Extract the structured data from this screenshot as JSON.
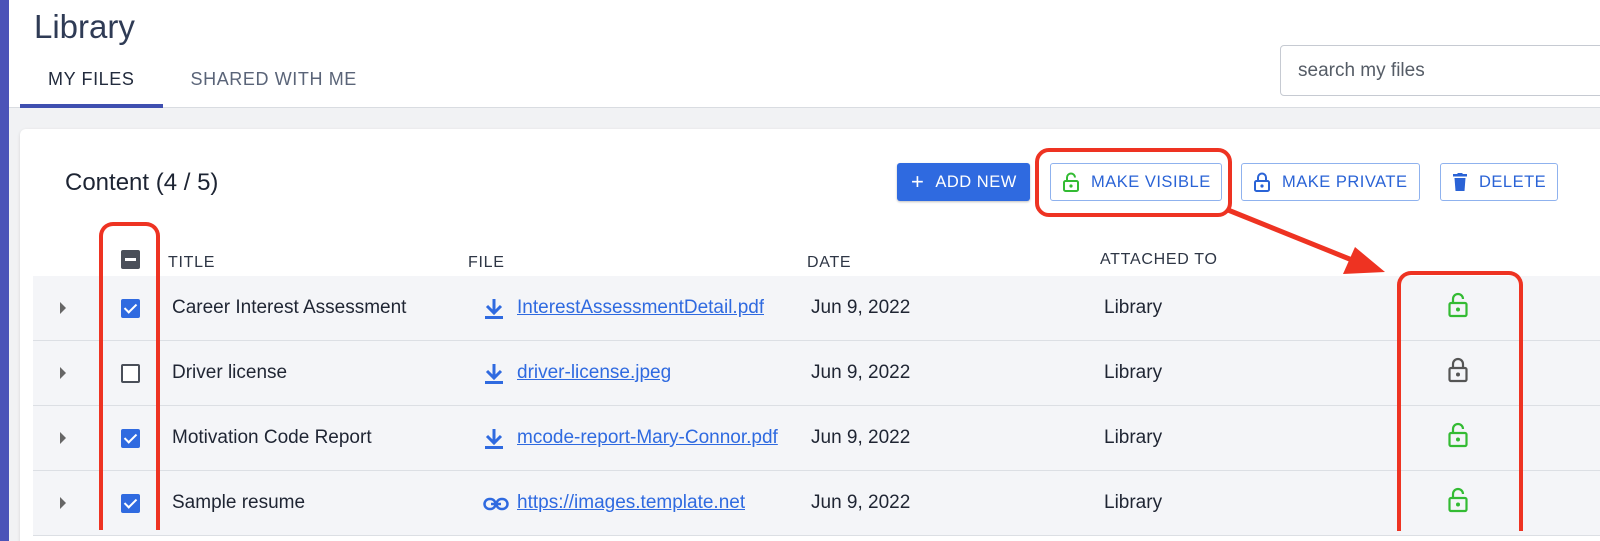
{
  "header": {
    "title": "Library",
    "tabs": [
      {
        "label": "MY FILES",
        "active": true
      },
      {
        "label": "SHARED WITH ME",
        "active": false
      }
    ],
    "search": {
      "placeholder": "search my files",
      "value": ""
    }
  },
  "content": {
    "title": "Content (4 / 5)",
    "toolbar": {
      "add_new": "ADD NEW",
      "make_visible": "MAKE VISIBLE",
      "make_private": "MAKE PRIVATE",
      "delete": "DELETE"
    },
    "columns": [
      "TITLE",
      "FILE",
      "DATE",
      "ATTACHED TO"
    ],
    "rows": [
      {
        "title": "Career Interest Assessment",
        "file": "InterestAssessmentDetail.pdf",
        "file_icon": "download-icon",
        "date": "Jun 9, 2022",
        "attached_to": "Library",
        "checked": true,
        "visibility": "visible"
      },
      {
        "title": "Driver license",
        "file": "driver-license.jpeg",
        "file_icon": "download-icon",
        "date": "Jun 9, 2022",
        "attached_to": "Library",
        "checked": false,
        "visibility": "private"
      },
      {
        "title": "Motivation Code Report",
        "file": "mcode-report-Mary-Connor.pdf",
        "file_icon": "download-icon",
        "date": "Jun 9, 2022",
        "attached_to": "Library",
        "checked": true,
        "visibility": "visible"
      },
      {
        "title": "Sample resume",
        "file": "https://images.template.net",
        "file_icon": "link-icon",
        "date": "Jun 9, 2022",
        "attached_to": "Library",
        "checked": true,
        "visibility": "visible"
      }
    ]
  },
  "colors": {
    "accent": "#2f6ae0",
    "visible_lock": "#33bb33",
    "private_lock": "#555555",
    "annotation": "#ee3322",
    "sidebar_strip": "#4b53b8"
  }
}
